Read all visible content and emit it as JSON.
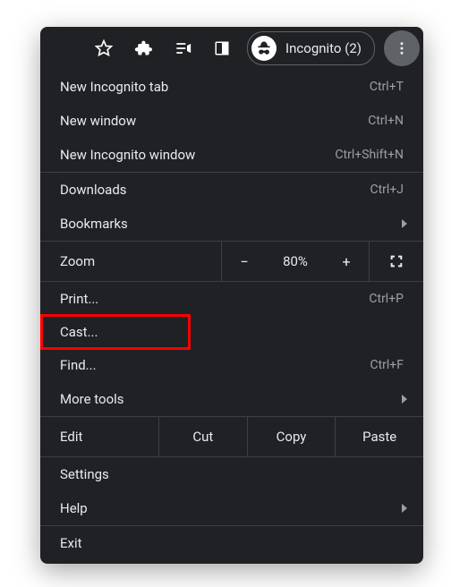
{
  "toolbar": {
    "incognito_label": "Incognito (2)"
  },
  "menu": {
    "new_incog_tab": {
      "label": "New Incognito tab",
      "shortcut": "Ctrl+T"
    },
    "new_window": {
      "label": "New window",
      "shortcut": "Ctrl+N"
    },
    "new_incog_window": {
      "label": "New Incognito window",
      "shortcut": "Ctrl+Shift+N"
    },
    "downloads": {
      "label": "Downloads",
      "shortcut": "Ctrl+J"
    },
    "bookmarks": {
      "label": "Bookmarks"
    },
    "zoom": {
      "label": "Zoom",
      "value": "80%"
    },
    "print": {
      "label": "Print...",
      "shortcut": "Ctrl+P"
    },
    "cast": {
      "label": "Cast..."
    },
    "find": {
      "label": "Find...",
      "shortcut": "Ctrl+F"
    },
    "more_tools": {
      "label": "More tools"
    },
    "edit": {
      "label": "Edit",
      "cut": "Cut",
      "copy": "Copy",
      "paste": "Paste"
    },
    "settings": {
      "label": "Settings"
    },
    "help": {
      "label": "Help"
    },
    "exit": {
      "label": "Exit"
    }
  }
}
